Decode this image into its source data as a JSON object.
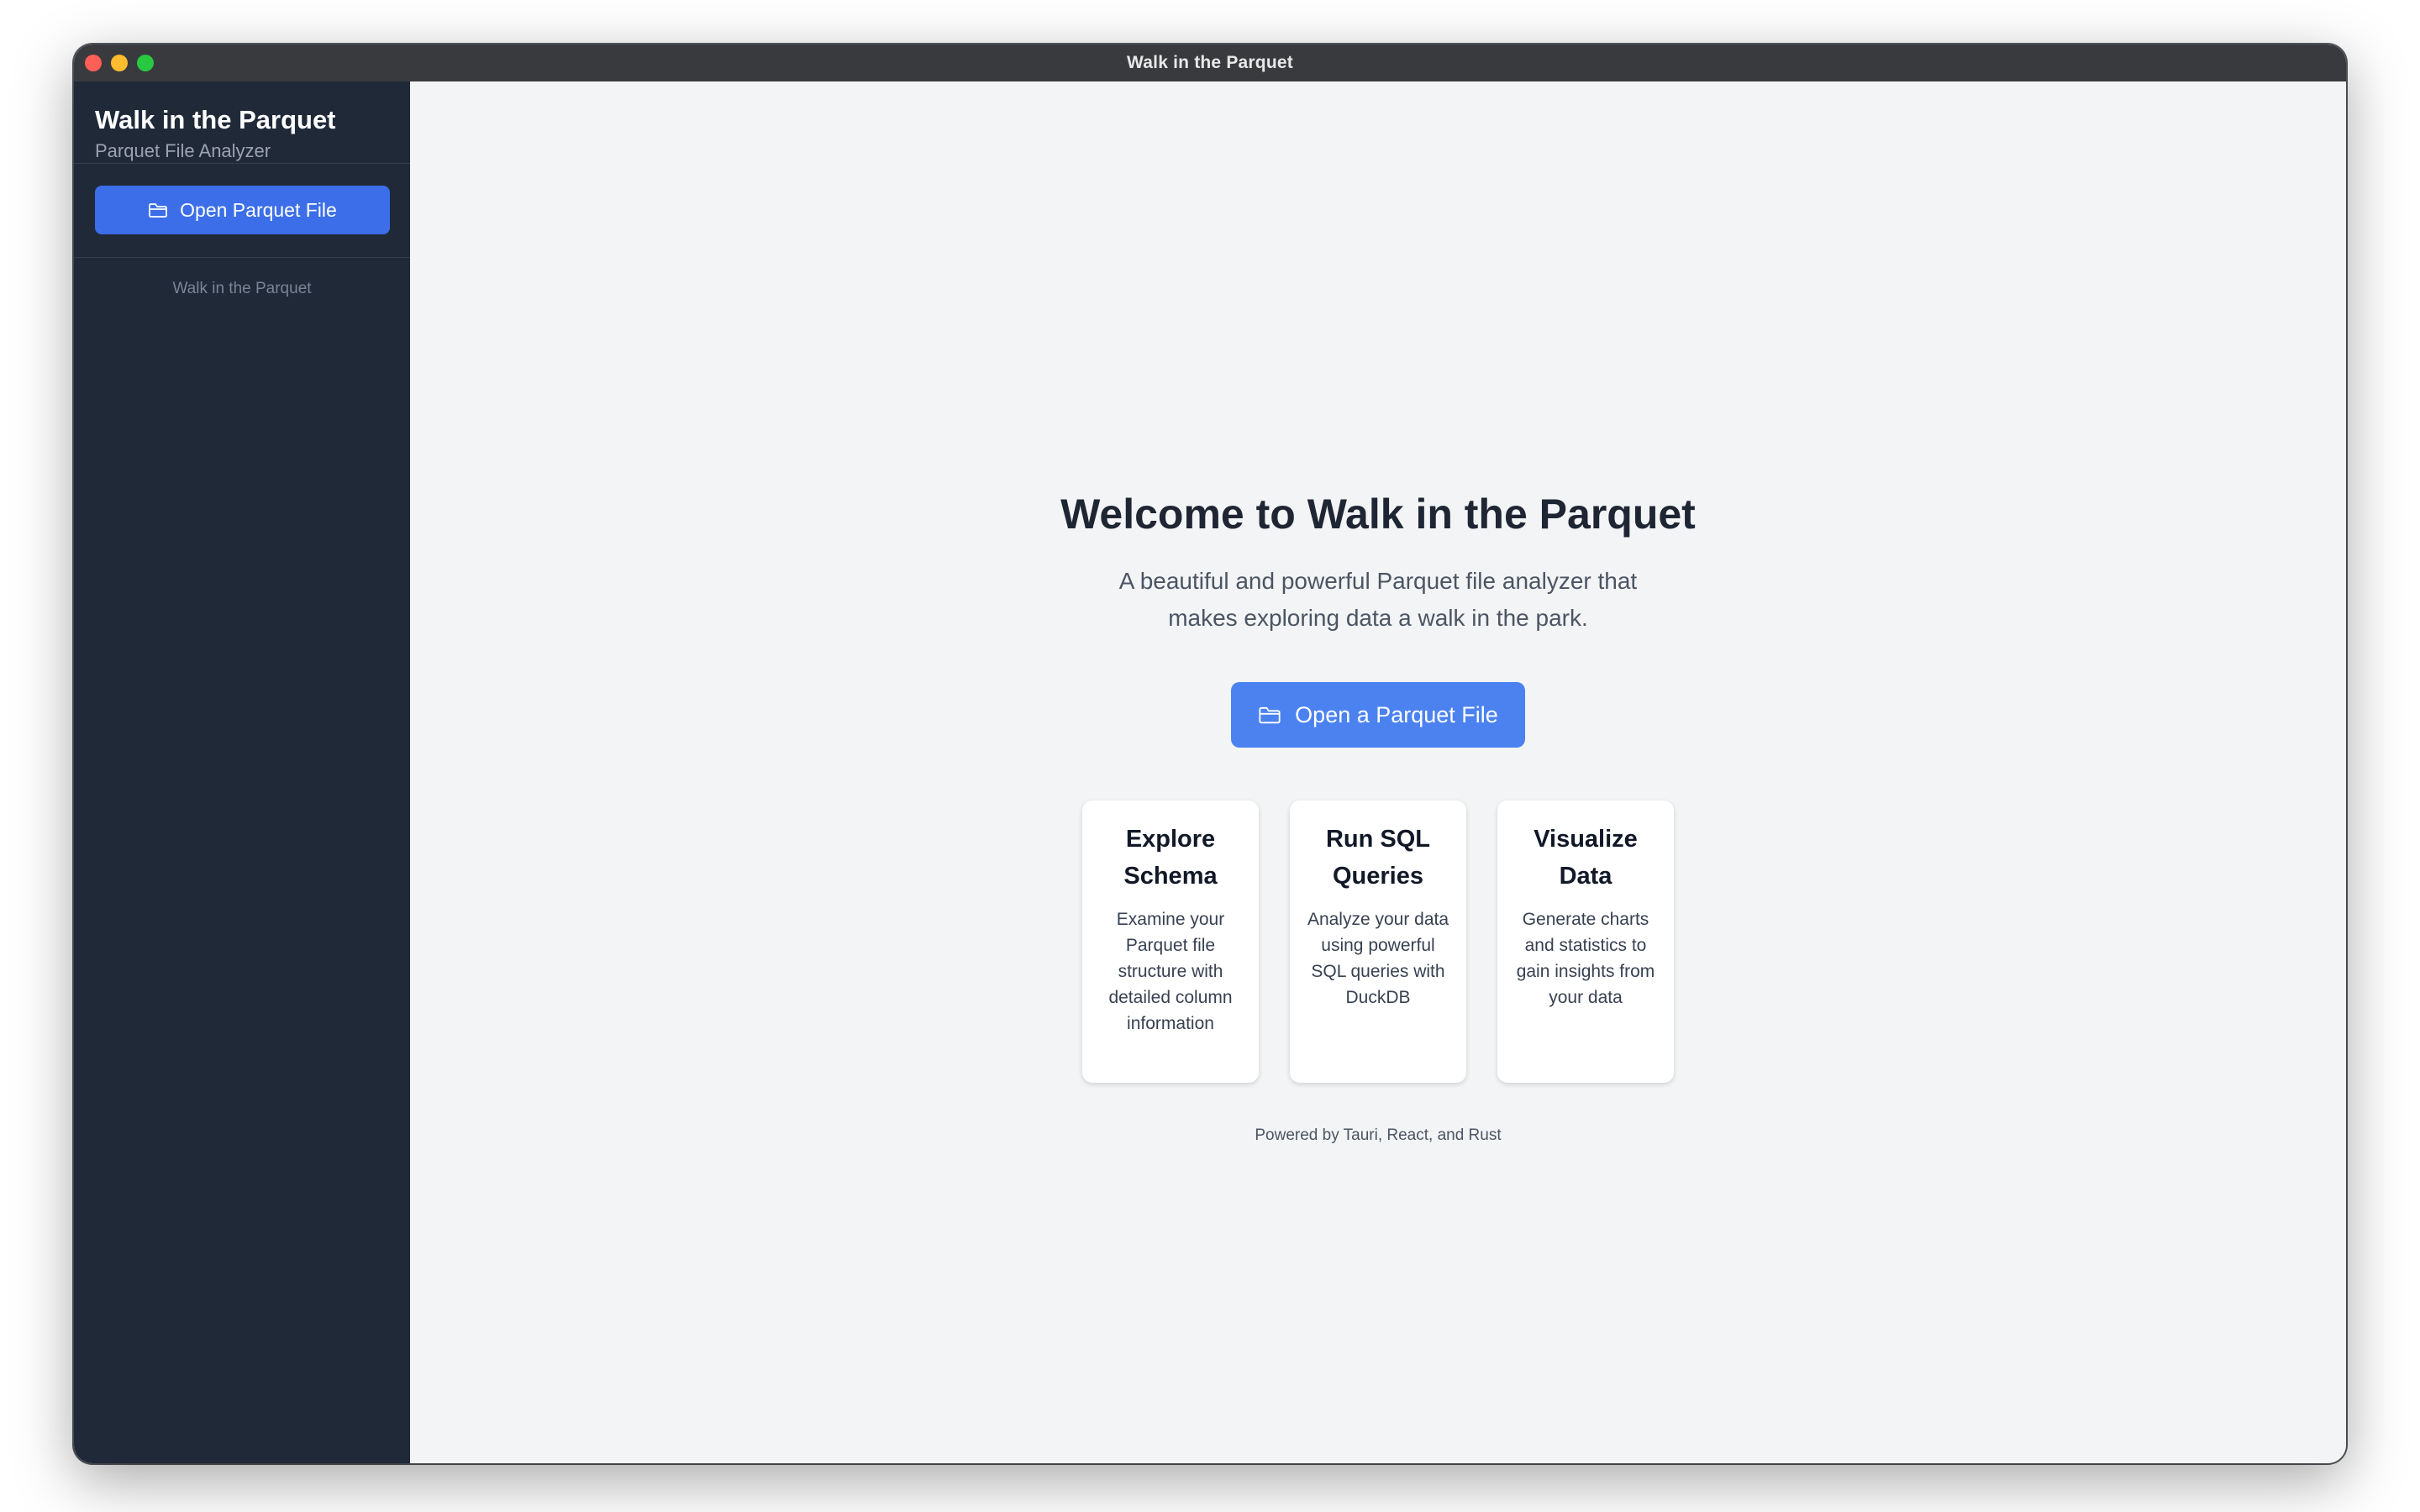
{
  "window": {
    "title": "Walk in the Parquet"
  },
  "sidebar": {
    "app_title": "Walk in the Parquet",
    "app_subtitle": "Parquet File Analyzer",
    "open_button_label": "Open Parquet File",
    "footer_text": "Walk in the Parquet"
  },
  "main": {
    "heading": "Welcome to Walk in the Parquet",
    "description": "A beautiful and powerful Parquet file analyzer that makes exploring data a walk in the park.",
    "cta_label": "Open a Parquet File",
    "features": [
      {
        "title": "Explore Schema",
        "text": "Examine your Parquet file structure with detailed column information"
      },
      {
        "title": "Run SQL Queries",
        "text": "Analyze your data using powerful SQL queries with DuckDB"
      },
      {
        "title": "Visualize Data",
        "text": "Generate charts and statistics to gain insights from your data"
      }
    ],
    "powered_by": "Powered by Tauri, React, and Rust"
  },
  "icons": {
    "open_button": "folder-icon",
    "cta": "folder-icon"
  },
  "colors": {
    "sidebar_bg": "#202938",
    "primary_button": "#3b6ee8",
    "cta_button": "#4b82f0",
    "main_bg": "#f3f4f6"
  }
}
